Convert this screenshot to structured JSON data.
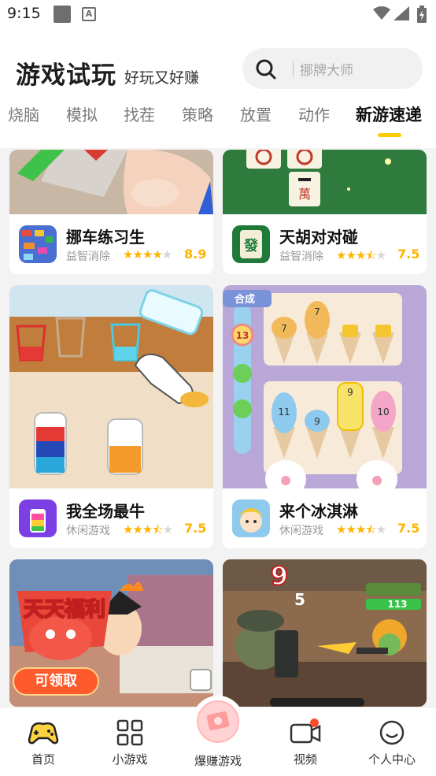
{
  "status_bar": {
    "time": "9:15"
  },
  "header": {
    "title": "游戏试玩",
    "subtitle": "好玩又好赚",
    "search_placeholder": "挪牌大师"
  },
  "tabs": [
    {
      "label": "烧脑"
    },
    {
      "label": "模拟"
    },
    {
      "label": "找茬"
    },
    {
      "label": "策略"
    },
    {
      "label": "放置"
    },
    {
      "label": "动作"
    },
    {
      "label": "新游速递",
      "active": true
    }
  ],
  "games": [
    {
      "name": "挪车练习生",
      "category": "益智消除",
      "rating": "8.9",
      "stars": 4.5
    },
    {
      "name": "天胡对对碰",
      "category": "益智消除",
      "rating": "7.5",
      "stars": 3.5
    },
    {
      "name": "我全场最牛",
      "category": "休闲游戏",
      "rating": "7.5",
      "stars": 3.5
    },
    {
      "name": "来个冰淇淋",
      "category": "休闲游戏",
      "rating": "7.5",
      "stars": 3.5
    }
  ],
  "promo": {
    "banner_text": "天天福利",
    "button_label": "可领取",
    "combo": "9",
    "hit": "5",
    "hp": "113",
    "merge_label": "合成",
    "level_badge": "13",
    "cups": [
      "7",
      "7",
      "11",
      "9",
      "9",
      "10"
    ]
  },
  "bottom_nav": [
    {
      "label": "首页",
      "icon": "gamepad-icon"
    },
    {
      "label": "小游戏",
      "icon": "grid-icon"
    },
    {
      "label": "爆赚游戏",
      "icon": "money-icon"
    },
    {
      "label": "视频",
      "icon": "video-icon"
    },
    {
      "label": "个人中心",
      "icon": "smile-icon"
    }
  ],
  "colors": {
    "accent": "#ffcc00",
    "star": "#ffb400",
    "notification": "#ff4b2b"
  }
}
